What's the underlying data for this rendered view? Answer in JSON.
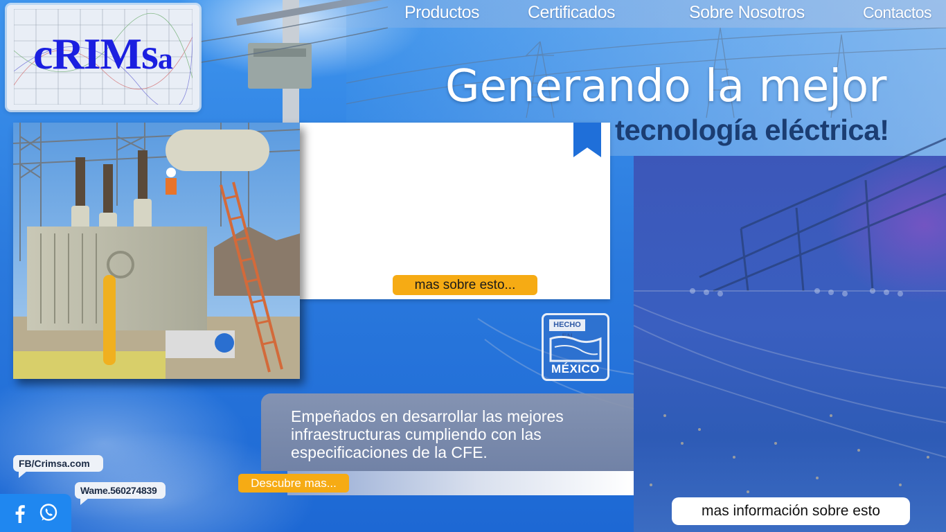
{
  "brand": {
    "logo_main": "cRIMs",
    "logo_last": "a"
  },
  "nav": {
    "items": [
      {
        "label": "Productos"
      },
      {
        "label": "Certificados"
      },
      {
        "label": "Sobre Nosotros"
      },
      {
        "label": "Contactos"
      }
    ]
  },
  "hero": {
    "line1": "Generando la mejor",
    "line2": "tecnología eléctrica!"
  },
  "panel": {
    "more_button": "mas sobre esto..."
  },
  "badge": {
    "top": "HECHO EN",
    "bottom": "MÉXICO"
  },
  "info": {
    "text": "Empeñados en desarrollar las mejores\n infraestructuras cumpliendo con las\nespecificaciones de la CFE.",
    "discover_button": "Descubre mas..."
  },
  "more_info_button": "mas información sobre esto",
  "social": {
    "facebook_text": "FB/Crimsa.com",
    "whatsapp_text": "Wame.560274839",
    "icons": [
      "facebook-icon",
      "whatsapp-icon"
    ]
  },
  "colors": {
    "accent_orange": "#f6ab14",
    "logo_blue": "#1b1fe0",
    "heading_dark": "#1b3d72"
  }
}
